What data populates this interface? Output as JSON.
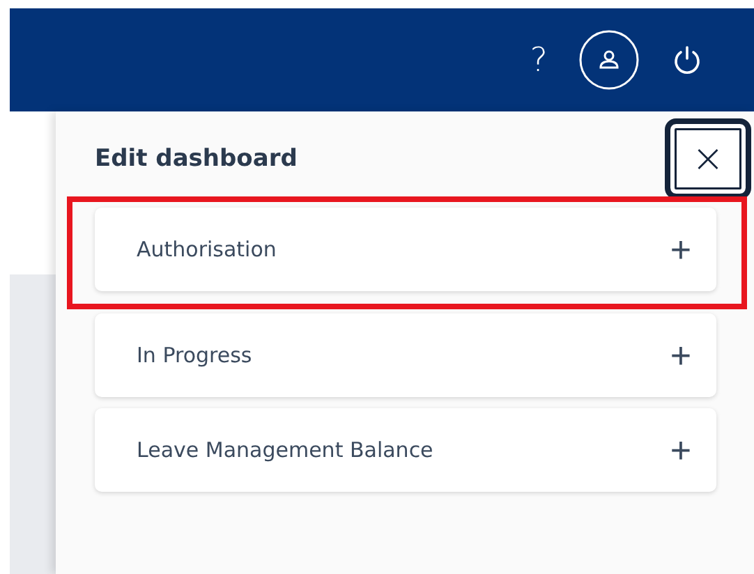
{
  "header": {
    "help": "?"
  },
  "panel": {
    "title": "Edit dashboard",
    "close": "×",
    "items": [
      {
        "label": "Authorisation",
        "action": "+",
        "highlighted": true
      },
      {
        "label": "In Progress",
        "action": "+",
        "highlighted": false
      },
      {
        "label": "Leave Management Balance",
        "action": "+",
        "highlighted": false
      }
    ]
  }
}
